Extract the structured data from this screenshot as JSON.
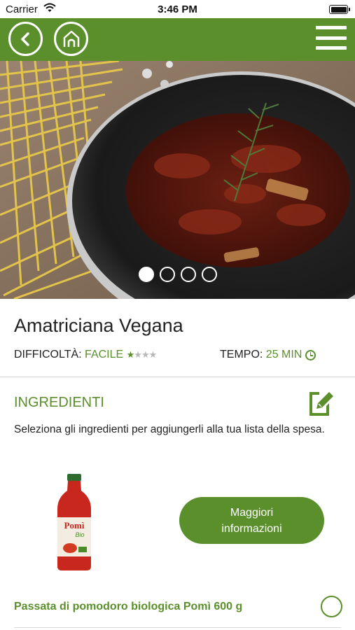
{
  "status_bar": {
    "carrier": "Carrier",
    "time": "3:46 PM",
    "icons": [
      "wifi-icon",
      "battery-icon"
    ]
  },
  "nav": {
    "icons": [
      "back-arrow-icon",
      "home-icon",
      "hamburger-menu-icon"
    ]
  },
  "carousel": {
    "slide_count": 4,
    "active_index": 0
  },
  "recipe": {
    "title": "Amatriciana Vegana",
    "difficulty_label": "DIFFICOLTÀ:",
    "difficulty_value": "FACILE",
    "difficulty_stars": 1,
    "difficulty_stars_max": 4,
    "time_label": "TEMPO:",
    "time_value": "25 MIN"
  },
  "ingredients": {
    "title": "INGREDIENTI",
    "description": "Seleziona gli ingredienti per aggiungerli alla tua lista della spesa.",
    "items": [
      {
        "name": "Passata di pomodoro biologica Pomì 600 g",
        "button_label": "Maggiori informazioni",
        "brand_text": "Pomì Bio",
        "selected": false
      }
    ]
  },
  "colors": {
    "brand_green": "#5a8f2b"
  }
}
